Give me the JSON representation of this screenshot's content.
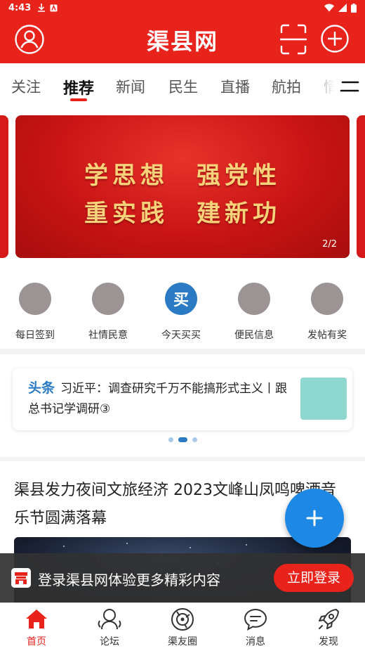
{
  "status_bar": {
    "time": "4:43"
  },
  "header": {
    "brand": "渠县网"
  },
  "tabs": [
    {
      "label": "关注"
    },
    {
      "label": "推荐"
    },
    {
      "label": "新闻"
    },
    {
      "label": "民生"
    },
    {
      "label": "直播"
    },
    {
      "label": "航拍"
    },
    {
      "label": "情"
    }
  ],
  "active_tab": "推荐",
  "banner": {
    "line1": "学思想　强党性",
    "line2": "重实践　建新功",
    "counter": "2/2"
  },
  "quick_links": [
    {
      "label": "每日签到",
      "glyph": ""
    },
    {
      "label": "社情民意",
      "glyph": ""
    },
    {
      "label": "今天买买",
      "glyph": "买"
    },
    {
      "label": "便民信息",
      "glyph": ""
    },
    {
      "label": "发帖有奖",
      "glyph": ""
    }
  ],
  "headline": {
    "tag": "头条",
    "text": "习近平：调查研究千万不能搞形式主义丨跟总书记学调研③",
    "dots": 3,
    "active_dot": 2
  },
  "article": {
    "title": "渠县发力夜间文旅经济 2023文峰山凤鸣啤酒音乐节圆满落幕"
  },
  "login_bar": {
    "text": "登录渠县网体验更多精彩内容",
    "button": "立即登录"
  },
  "bottom_nav": [
    {
      "label": "首页",
      "icon": "home-icon"
    },
    {
      "label": "论坛",
      "icon": "forum-icon"
    },
    {
      "label": "渠友圈",
      "icon": "moments-icon"
    },
    {
      "label": "消息",
      "icon": "message-icon"
    },
    {
      "label": "发现",
      "icon": "discover-icon"
    }
  ],
  "colors": {
    "brand_red": "#e8231c",
    "accent_blue": "#1e88e5",
    "banner_gold": "#f6d27a"
  }
}
